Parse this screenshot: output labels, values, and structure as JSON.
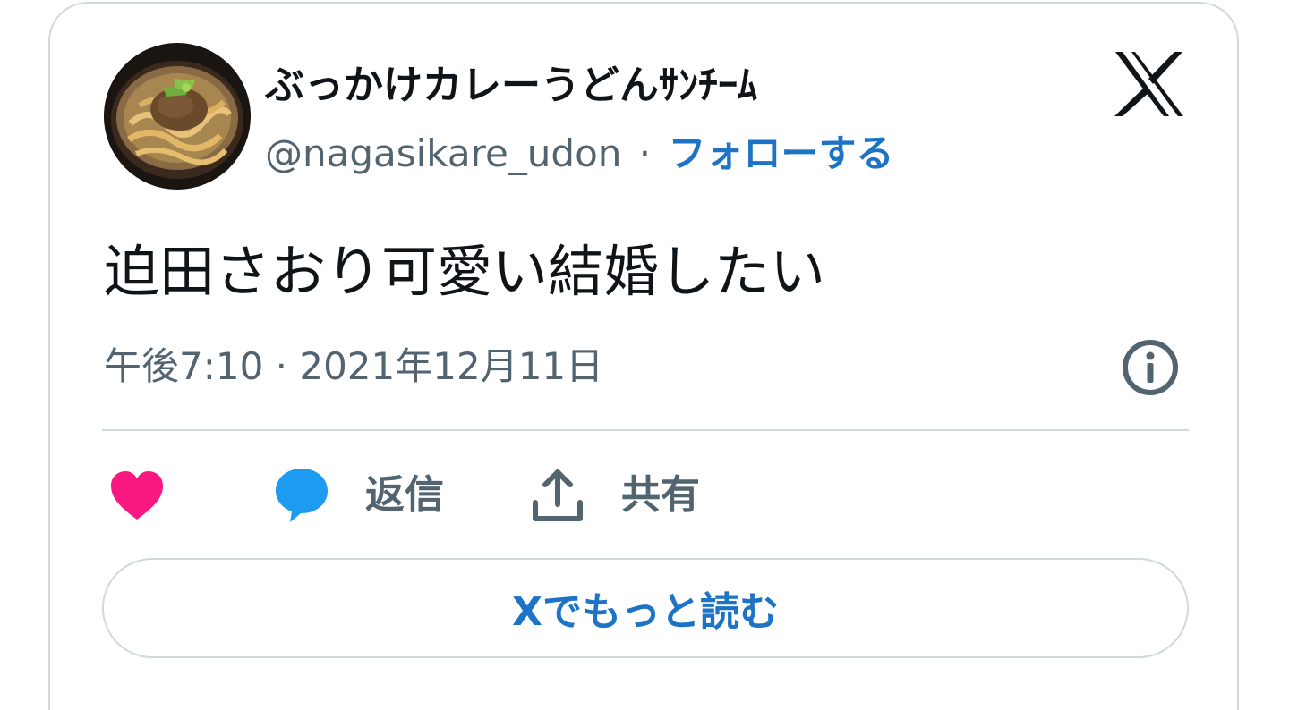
{
  "tweet": {
    "author": {
      "display_name": "ぶっかけカレーうどんｻﾝﾁｰﾑ",
      "handle": "@nagasikare_udon",
      "separator": "·",
      "follow_label": "フォローする",
      "avatar_icon": "curry-udon-avatar"
    },
    "text": "迫田さおり可愛い結婚したい",
    "timestamp": "午後7:10 · 2021年12月11日",
    "actions": {
      "like_icon": "heart-icon",
      "reply_label": "返信",
      "share_label": "共有"
    },
    "read_more_label": "Xでもっと読む",
    "brand_icon": "x-logo-icon",
    "info_icon": "info-icon"
  },
  "colors": {
    "text": "#0f1419",
    "secondary": "#536471",
    "link": "#1d73c5",
    "border": "#cfd9de",
    "like": "#f91880",
    "reply": "#1d9bf0"
  }
}
